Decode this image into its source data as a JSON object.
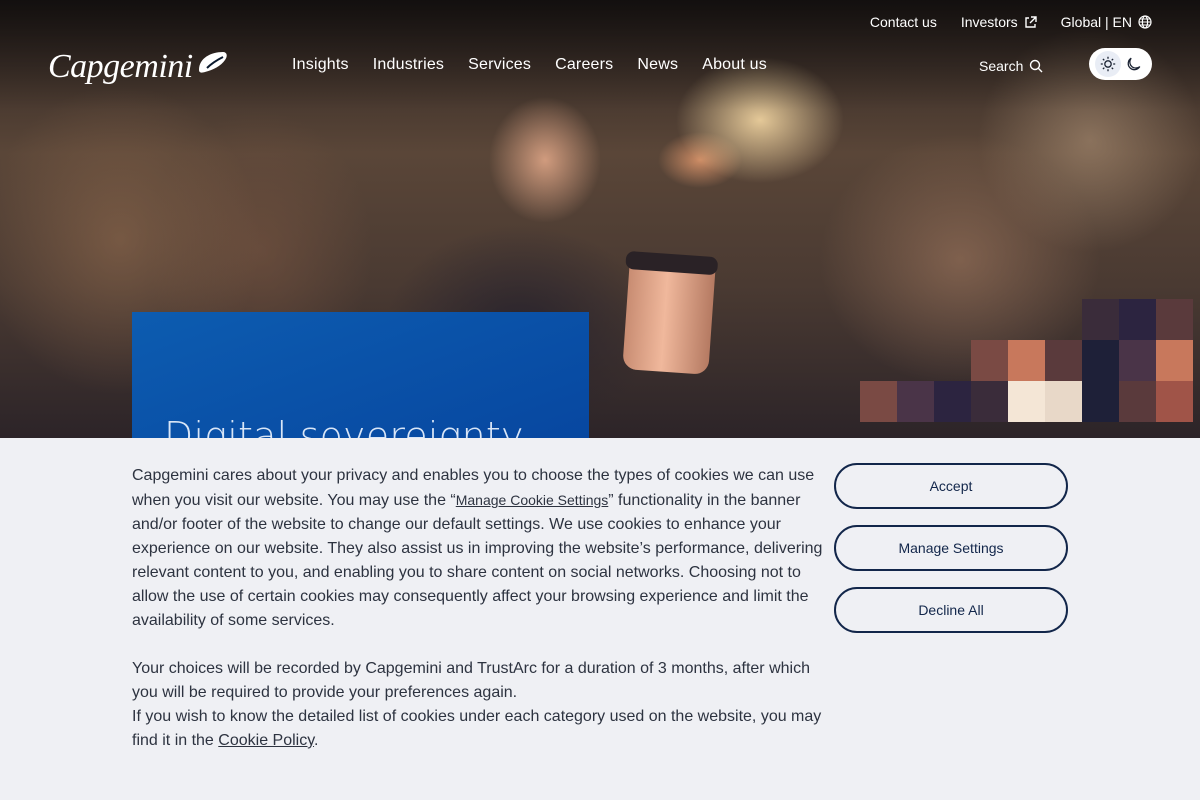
{
  "header": {
    "logo_text": "Capgemini",
    "utility_links": [
      {
        "label": "Contact us"
      },
      {
        "label": "Investors"
      },
      {
        "label": "Global | EN"
      }
    ],
    "nav": [
      "Insights",
      "Industries",
      "Services",
      "Careers",
      "News",
      "About us"
    ],
    "search_label": "Search",
    "theme_toggle": {
      "light_icon": "sun-icon",
      "dark_icon": "moon-icon",
      "selected": "light"
    }
  },
  "hero": {
    "title": "Digital sovereignty",
    "card_color": "#0b53a8"
  },
  "cookie_banner": {
    "para1_before": "Capgemini cares about your privacy and enables you to choose the types of cookies we can use when you visit our website. You may use the “",
    "para1_link": "Manage Cookie Settings",
    "para1_after": "” functionality in the banner and/or footer of the website to change our default settings. We use cookies to enhance your experience on our website. They also assist us in improving the website’s performance, delivering relevant content to you, and enabling you to share content on social networks. Choosing not to allow the use of certain cookies may consequently affect your browsing experience and limit the availability of some services.",
    "para2": "Your choices will be recorded by Capgemini and TrustArc for a duration of 3 months, after which you will be required to provide your preferences again.",
    "para3_before": "If you wish to know the detailed list of cookies under each category used on the website, you may find it in the ",
    "para3_link": "Cookie Policy",
    "para3_after": ".",
    "buttons": {
      "accept": "Accept",
      "manage": "Manage Settings",
      "decline": "Decline All"
    },
    "button_color": "#12264a",
    "background": "#eff0f4"
  }
}
